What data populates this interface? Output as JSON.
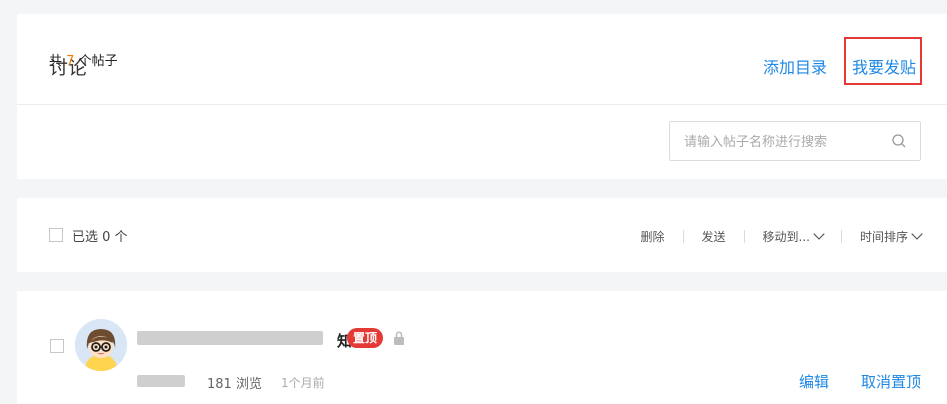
{
  "header": {
    "title": "讨论",
    "add_catalog": "添加目录",
    "post_button": "我要发贴"
  },
  "count": {
    "prefix": "共",
    "value": "7",
    "suffix": "个帖子"
  },
  "search": {
    "placeholder": "请输入帖子名称进行搜索",
    "icon": "search-icon"
  },
  "toolbar": {
    "selected_label": "已选 0 个",
    "delete": "删除",
    "send": "发送",
    "move_to": "移动到...",
    "sort": "时间排序"
  },
  "posts": [
    {
      "title_visible_tail": "知",
      "pin_badge": "置顶",
      "views": "181 浏览",
      "time": "1个月前",
      "edit": "编辑",
      "unpin": "取消置顶"
    }
  ],
  "colors": {
    "accent": "#1e88e5",
    "count_number": "#f57c00",
    "badge": "#e53935",
    "highlight_box": "#e53935"
  }
}
